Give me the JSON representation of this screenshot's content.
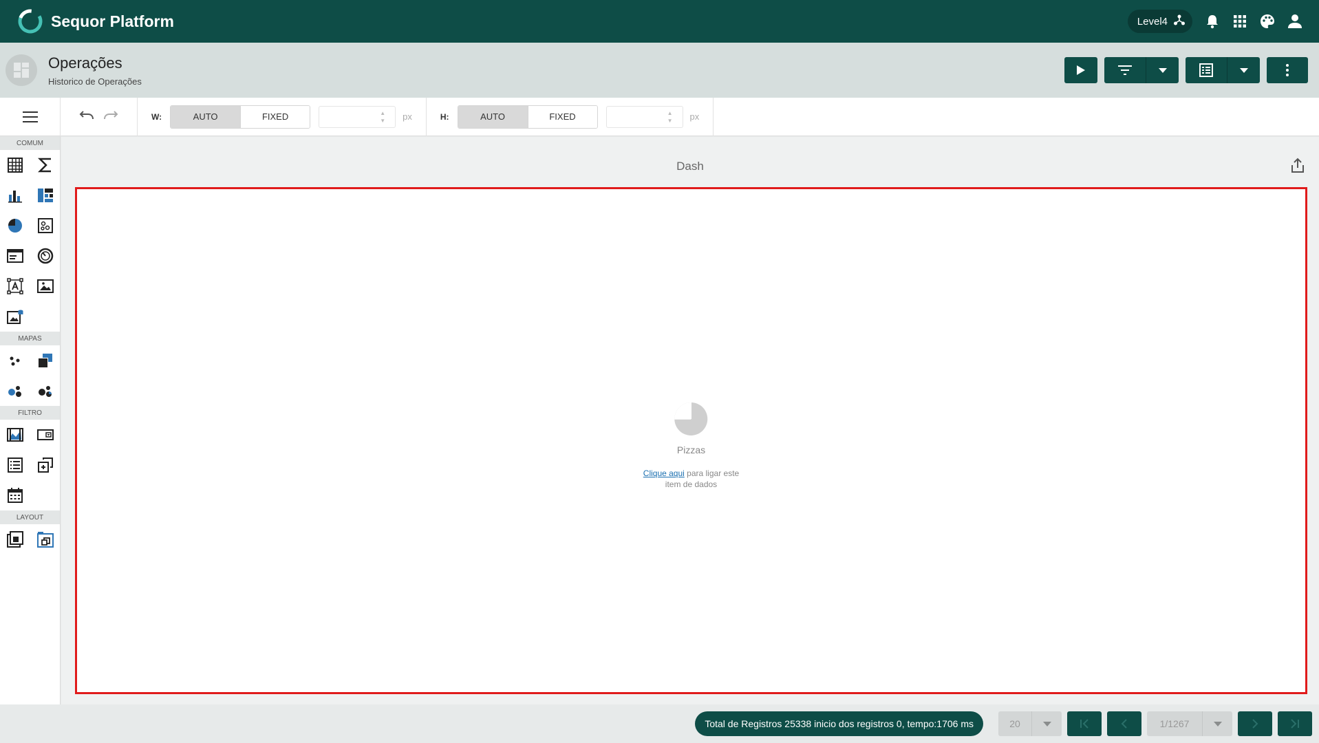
{
  "app": {
    "title": "Sequor Platform",
    "level_label": "Level4"
  },
  "page": {
    "title": "Operações",
    "subtitle": "Historico de Operações"
  },
  "toolbar": {
    "width_label": "W:",
    "height_label": "H:",
    "auto_label": "AUTO",
    "fixed_label": "FIXED",
    "unit": "px",
    "width_value": "",
    "height_value": ""
  },
  "palette": {
    "sections": [
      "COMUM",
      "MAPAS",
      "FILTRO",
      "LAYOUT"
    ]
  },
  "dashboard": {
    "title": "Dash",
    "item_name": "Pizzas",
    "link_text": "Clique aqui",
    "help_line1": " para ligar este",
    "help_line2": "item de dados"
  },
  "status": {
    "total_text": "Total de Registros 25338 inicio dos registros 0, tempo:1706 ms",
    "page_size": "20",
    "page_indicator": "1/1267"
  },
  "colors": {
    "primary": "#0e4d47",
    "accent_blue": "#2f76b6",
    "selection_red": "#e01b1b",
    "logo_teal": "#45c1b5"
  }
}
